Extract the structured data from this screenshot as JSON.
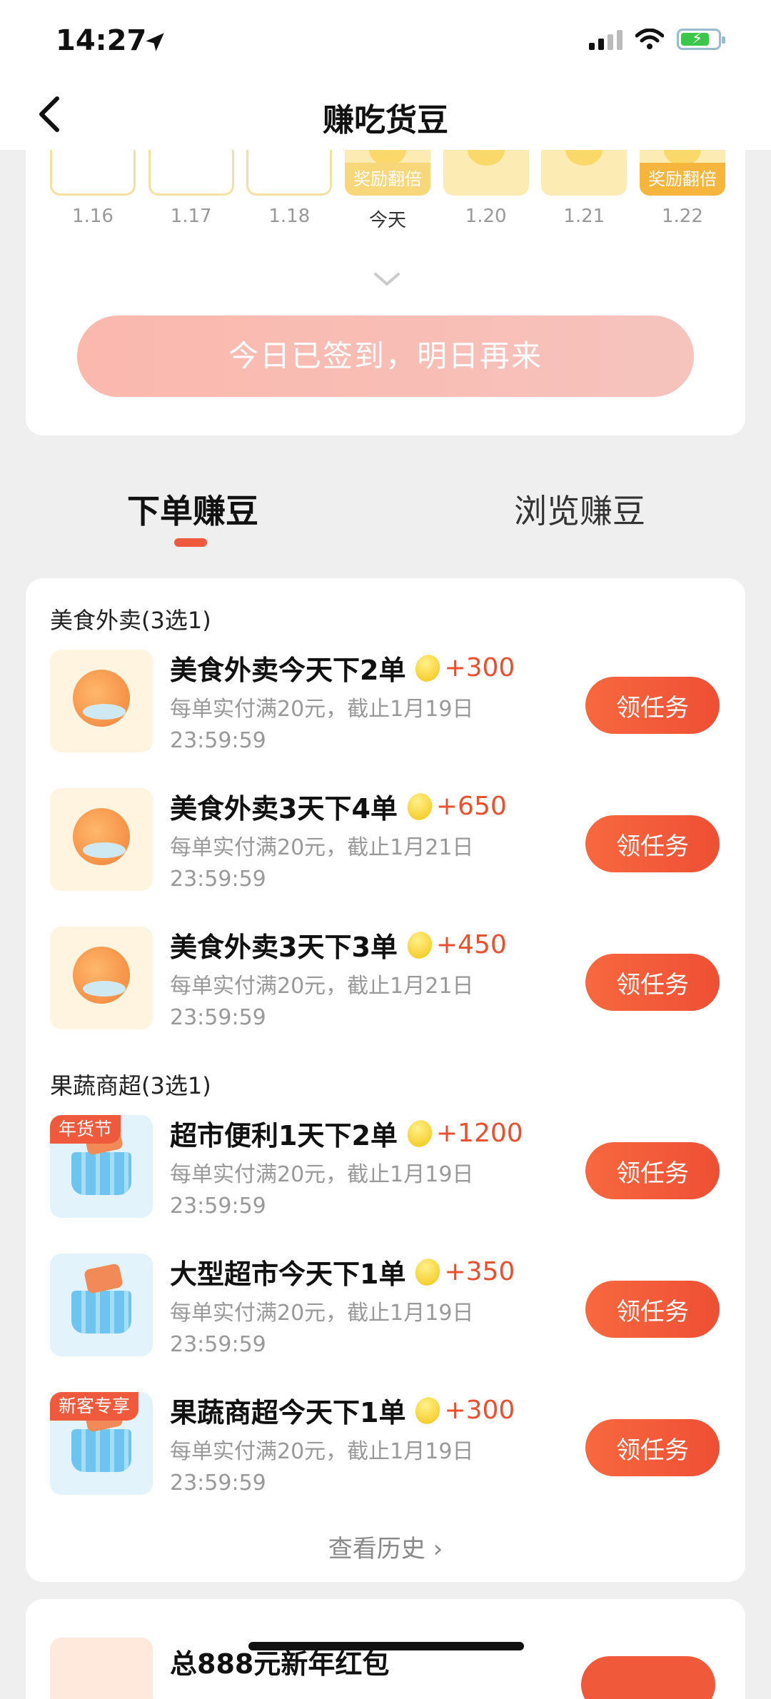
{
  "status_bar": {
    "time": "14:27"
  },
  "header": {
    "title": "赚吃货豆"
  },
  "checkin": {
    "days": [
      {
        "label": "1.16",
        "state": "empty",
        "badge": ""
      },
      {
        "label": "1.17",
        "state": "empty",
        "badge": ""
      },
      {
        "label": "1.18",
        "state": "empty",
        "badge": ""
      },
      {
        "label": "今天",
        "state": "badge",
        "badge": "奖励翻倍"
      },
      {
        "label": "1.20",
        "state": "coin",
        "badge": ""
      },
      {
        "label": "1.21",
        "state": "coin",
        "badge": ""
      },
      {
        "label": "1.22",
        "state": "badge-strong",
        "badge": "奖励翻倍"
      }
    ],
    "button_label": "今日已签到，明日再来"
  },
  "tabs": [
    {
      "label": "下单赚豆",
      "active": true
    },
    {
      "label": "浏览赚豆",
      "active": false
    }
  ],
  "sections": [
    {
      "title": "美食外卖(3选1)",
      "tasks": [
        {
          "title": "美食外卖今天下2单",
          "reward": "+300",
          "desc": "每单实付满20元，截止1月19日23:59:59",
          "button": "领任务",
          "thumb": "food",
          "tag": ""
        },
        {
          "title": "美食外卖3天下4单",
          "reward": "+650",
          "desc": "每单实付满20元，截止1月21日23:59:59",
          "button": "领任务",
          "thumb": "food",
          "tag": ""
        },
        {
          "title": "美食外卖3天下3单",
          "reward": "+450",
          "desc": "每单实付满20元，截止1月21日23:59:59",
          "button": "领任务",
          "thumb": "food",
          "tag": ""
        }
      ]
    },
    {
      "title": "果蔬商超(3选1)",
      "tasks": [
        {
          "title": "超市便利1天下2单",
          "reward": "+1200",
          "desc": "每单实付满20元，截止1月19日23:59:59",
          "button": "领任务",
          "thumb": "market",
          "tag": "年货节"
        },
        {
          "title": "大型超市今天下1单",
          "reward": "+350",
          "desc": "每单实付满20元，截止1月19日23:59:59",
          "button": "领任务",
          "thumb": "market",
          "tag": ""
        },
        {
          "title": "果蔬商超今天下1单",
          "reward": "+300",
          "desc": "每单实付满20元，截止1月19日23:59:59",
          "button": "领任务",
          "thumb": "market",
          "tag": "新客专享"
        }
      ]
    }
  ],
  "history_link": "查看历史 ›",
  "next_card": {
    "title": "总888元新年红包"
  },
  "colors": {
    "accent": "#ef5a3c",
    "reward": "#e8502f",
    "signed_button": "#fbb8ad"
  }
}
